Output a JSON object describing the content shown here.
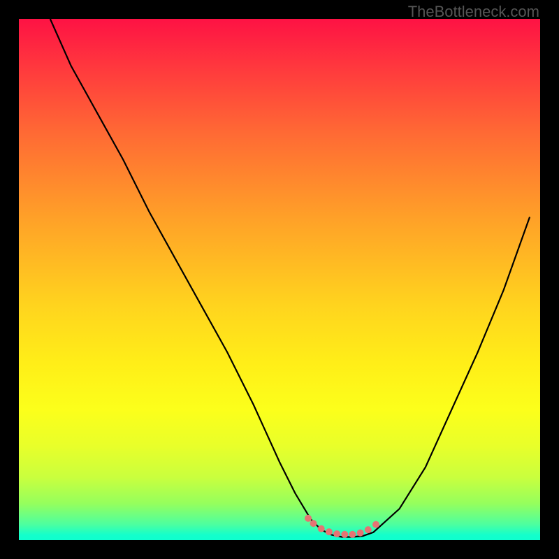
{
  "watermark": "TheBottleneck.com",
  "colors": {
    "background": "#000000",
    "gradient_top": "#fe1244",
    "gradient_bottom": "#14ffcb",
    "curve": "#000000",
    "dots": "#e57373"
  },
  "chart_data": {
    "type": "line",
    "title": "",
    "xlabel": "",
    "ylabel": "",
    "xlim": [
      0,
      100
    ],
    "ylim": [
      0,
      100
    ],
    "series": [
      {
        "name": "curve",
        "x": [
          6,
          10,
          15,
          20,
          25,
          30,
          35,
          40,
          45,
          50,
          53,
          56,
          58,
          60,
          62,
          64,
          66,
          68,
          73,
          78,
          83,
          88,
          93,
          98
        ],
        "y": [
          100,
          91,
          82,
          73,
          63,
          54,
          45,
          36,
          26,
          15,
          9,
          4,
          2,
          1,
          0.6,
          0.6,
          0.8,
          1.5,
          6,
          14,
          25,
          36,
          48,
          62
        ]
      },
      {
        "name": "dots",
        "x": [
          55.5,
          56.5,
          58,
          59.5,
          61,
          62.5,
          64,
          65.5,
          67,
          68.5
        ],
        "y": [
          4.2,
          3.2,
          2.2,
          1.6,
          1.2,
          1.1,
          1.1,
          1.4,
          2.0,
          3.0
        ]
      }
    ]
  }
}
